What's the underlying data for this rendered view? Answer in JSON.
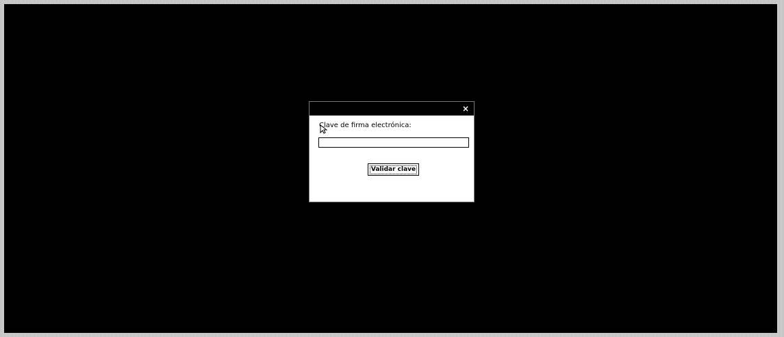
{
  "dialog": {
    "title": "",
    "close_icon": "close-icon",
    "close_glyph": "×",
    "field_label": "Clave de firma electrónica:",
    "password_value": "",
    "password_placeholder": "",
    "button_label": "Validar clave"
  },
  "colors": {
    "screen_background": "#000000",
    "dialog_background": "#ffffff",
    "titlebar": "#000000"
  }
}
